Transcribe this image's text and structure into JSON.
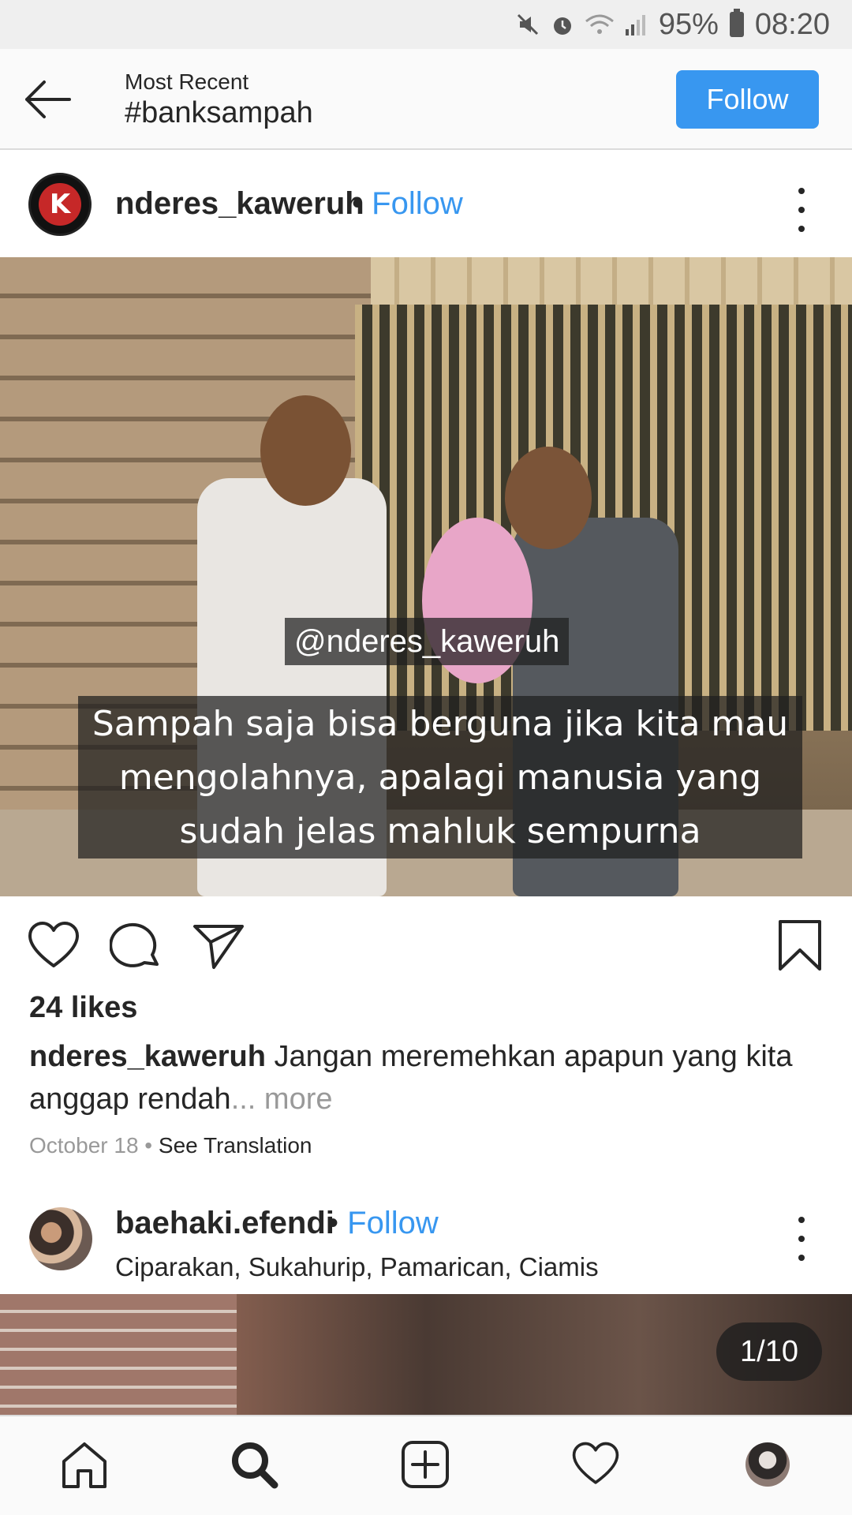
{
  "status_bar": {
    "battery": "95%",
    "time": "08:20",
    "icons": [
      "mute-icon",
      "alarm-icon",
      "wifi-icon",
      "signal-icon",
      "battery-icon"
    ]
  },
  "header": {
    "subtitle": "Most Recent",
    "title": "#banksampah",
    "follow_label": "Follow"
  },
  "post1": {
    "username": "nderes_kaweruh",
    "separator": "•",
    "follow_label": "Follow",
    "overlay_handle": "@nderes_kaweruh",
    "overlay_caption": "Sampah saja bisa berguna jika kita mau mengolahnya, apalagi manusia yang sudah jelas mahluk sempurna",
    "likes": "24 likes",
    "caption_user": "nderes_kaweruh",
    "caption_text": "Jangan meremehkan apapun yang kita anggap rendah",
    "caption_more": "... more",
    "date": "October 18",
    "meta_sep": " • ",
    "see_translation": "See Translation"
  },
  "post2": {
    "username": "baehaki.efendi",
    "separator": "•",
    "follow_label": "Follow",
    "location": "Ciparakan, Sukahurip, Pamarican, Ciamis",
    "counter": "1/10"
  },
  "colors": {
    "accent": "#3897f0",
    "text": "#262626",
    "muted": "#999999"
  },
  "bottom_nav": [
    "home-icon",
    "search-icon",
    "add-post-icon",
    "activity-heart-icon",
    "profile-avatar"
  ]
}
